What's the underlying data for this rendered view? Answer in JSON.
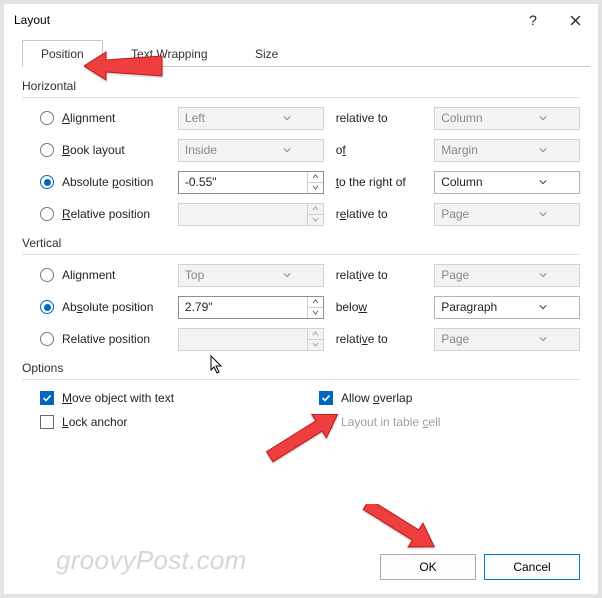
{
  "title": "Layout",
  "tabs": {
    "position": "Position",
    "wrap": "Text Wrapping",
    "size": "Size"
  },
  "groups": {
    "horizontal": "Horizontal",
    "vertical": "Vertical",
    "options": "Options"
  },
  "h": {
    "align_label": "Alignment",
    "align_value": "Left",
    "align_rel_label": "relative to",
    "align_rel_value": "Column",
    "book_label": "Book layout",
    "book_value": "Inside",
    "book_rel_label": "of",
    "book_rel_value": "Margin",
    "abs_label": "Absolute position",
    "abs_value": "-0.55\"",
    "abs_rel_label": "to the right of",
    "abs_rel_value": "Column",
    "rel_label": "Relative position",
    "rel_value": "",
    "rel_rel_label": "relative to",
    "rel_rel_value": "Page"
  },
  "v": {
    "align_label": "Alignment",
    "align_value": "Top",
    "align_rel_label": "relative to",
    "align_rel_value": "Page",
    "abs_label": "Absolute position",
    "abs_value": "2.79\"",
    "abs_rel_label": "below",
    "abs_rel_value": "Paragraph",
    "rel_label": "Relative position",
    "rel_value": "",
    "rel_rel_label": "relative to",
    "rel_rel_value": "Page"
  },
  "opts": {
    "move": "Move object with text",
    "lock": "Lock anchor",
    "overlap": "Allow overlap",
    "tablecell": "Layout in table cell"
  },
  "buttons": {
    "ok": "OK",
    "cancel": "Cancel"
  },
  "watermark": "groovyPost.com"
}
